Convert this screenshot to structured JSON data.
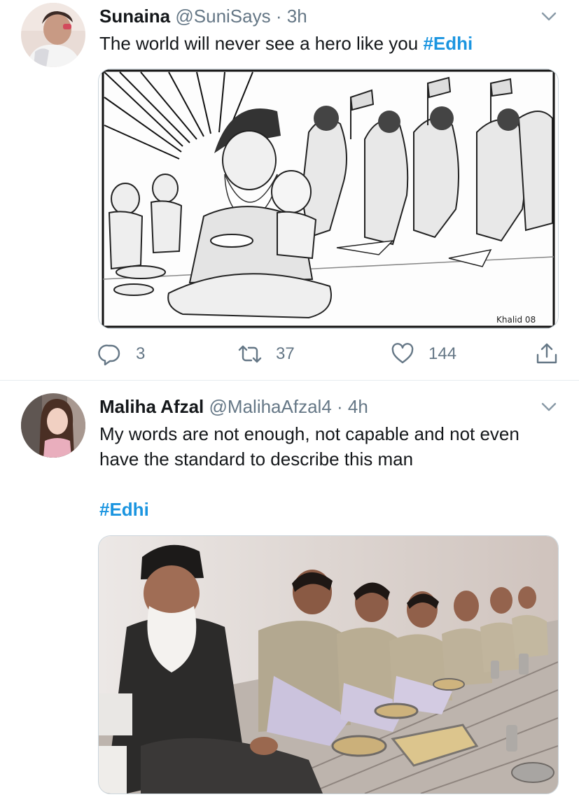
{
  "tweets": [
    {
      "name": "Sunaina",
      "handle": "@SuniSays",
      "dot": "·",
      "time": "3h",
      "text": "The world will never see a hero like you ",
      "hashtag": "#Edhi",
      "image_signature": "Khalid 08",
      "replies": "3",
      "retweets": "37",
      "likes": "144"
    },
    {
      "name": "Maliha Afzal",
      "handle": "@MalihaAfzal4",
      "dot": "·",
      "time": "4h",
      "text": "My words are not enough, not capable and not even have the standard to describe this man",
      "hashtag": "#Edhi"
    }
  ],
  "icons": {
    "reply": "reply-icon",
    "retweet": "retweet-icon",
    "like": "heart-icon",
    "share": "share-icon",
    "menu": "chevron-down-icon"
  },
  "colors": {
    "link": "#1b95e0",
    "secondary": "#657786",
    "divider": "#e6ecf0"
  }
}
